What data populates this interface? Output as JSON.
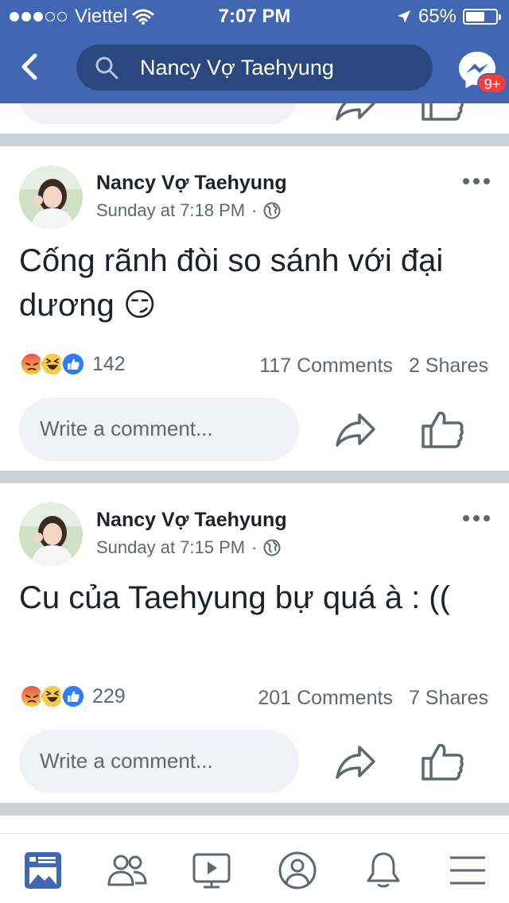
{
  "status_bar": {
    "carrier": "Viettel",
    "time": "7:07 PM",
    "battery": "65%",
    "battery_level": 0.65
  },
  "nav": {
    "search_text": "Nancy Vợ Taehyung",
    "messenger_badge": "9+"
  },
  "posts": [
    {
      "author": "Nancy Vợ Taehyung",
      "time": "Sunday at 7:18 PM",
      "separator": "·",
      "text": "Cống rãnh đòi so sánh với đại dương 😏",
      "reaction_count": "142",
      "comments": "117 Comments",
      "shares": "2 Shares",
      "comment_placeholder": "Write a comment..."
    },
    {
      "author": "Nancy Vợ Taehyung",
      "time": "Sunday at 7:15 PM",
      "separator": "·",
      "text": "Cu của Taehyung bự quá à : ((",
      "reaction_count": "229",
      "comments": "201 Comments",
      "shares": "7 Shares",
      "comment_placeholder": "Write a comment..."
    }
  ],
  "colors": {
    "brand": "#4267b2",
    "search_bg": "#29487d",
    "badge": "#fa3e3e",
    "secondary_text": "#606770",
    "active_tab": "#4267b2"
  },
  "tabs": [
    {
      "icon": "news-feed-icon",
      "active": true
    },
    {
      "icon": "friends-icon",
      "active": false
    },
    {
      "icon": "watch-icon",
      "active": false
    },
    {
      "icon": "profile-icon",
      "active": false
    },
    {
      "icon": "notifications-icon",
      "active": false
    },
    {
      "icon": "menu-icon",
      "active": false
    }
  ]
}
